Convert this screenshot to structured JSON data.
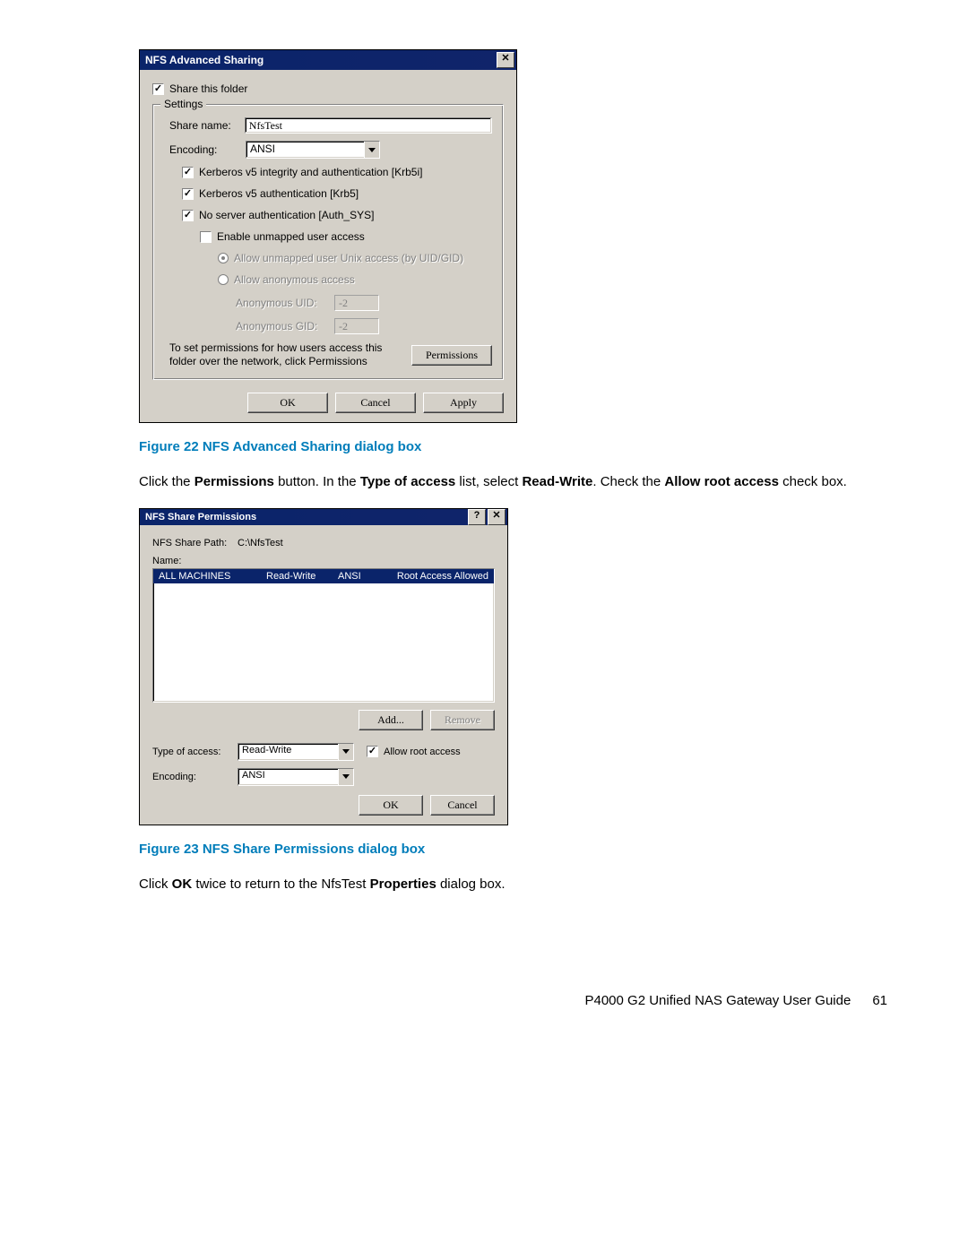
{
  "dialog1": {
    "title": "NFS Advanced Sharing",
    "close_glyph": "✕",
    "share_folder_chk": {
      "label": "Share this folder",
      "checked": true
    },
    "groupbox_label": "Settings",
    "share_name_label": "Share name:",
    "share_name_value": "NfsTest",
    "encoding_label": "Encoding:",
    "encoding_value": "ANSI",
    "krb5i": {
      "label": "Kerberos v5 integrity and authentication [Krb5i]",
      "checked": true
    },
    "krb5": {
      "label": "Kerberos v5 authentication [Krb5]",
      "checked": true
    },
    "authsys": {
      "label": "No server authentication [Auth_SYS]",
      "checked": true
    },
    "unmapped": {
      "label": "Enable unmapped user access",
      "checked": false
    },
    "radio_uidgid": "Allow unmapped user Unix access (by UID/GID)",
    "radio_anon": "Allow anonymous access",
    "anon_uid_label": "Anonymous UID:",
    "anon_uid_value": "-2",
    "anon_gid_label": "Anonymous GID:",
    "anon_gid_value": "-2",
    "perm_text1": "To set permissions for how users access this",
    "perm_text2": "folder over the network, click Permissions",
    "btn_permissions": "Permissions",
    "btn_ok": "OK",
    "btn_cancel": "Cancel",
    "btn_apply": "Apply"
  },
  "fig22": "Figure 22 NFS Advanced Sharing dialog box",
  "para1": {
    "t1": "Click the ",
    "b1": "Permissions",
    "t2": " button. In the ",
    "b2": "Type of access",
    "t3": " list, select ",
    "b3": "Read-Write",
    "t4": ". Check the ",
    "b4": "Allow root access",
    "t5": " check box."
  },
  "dialog2": {
    "title": "NFS Share Permissions",
    "help_glyph": "?",
    "close_glyph": "✕",
    "path_label": "NFS Share Path:",
    "path_value": "C:\\NfsTest",
    "name_label": "Name:",
    "row": {
      "name": "ALL MACHINES",
      "access": "Read-Write",
      "encoding": "ANSI",
      "root": "Root Access Allowed"
    },
    "btn_add": "Add...",
    "btn_remove": "Remove",
    "type_label": "Type of access:",
    "type_value": "Read-Write",
    "allow_root": {
      "label": "Allow root access",
      "checked": true
    },
    "encoding_label": "Encoding:",
    "encoding_value": "ANSI",
    "btn_ok": "OK",
    "btn_cancel": "Cancel"
  },
  "fig23": "Figure 23 NFS Share Permissions dialog box",
  "para2": {
    "t1": "Click ",
    "b1": "OK",
    "t2": " twice to return to the NfsTest ",
    "b2": "Properties",
    "t3": " dialog box."
  },
  "footer": {
    "guide": "P4000 G2 Unified NAS Gateway User Guide",
    "page": "61"
  }
}
